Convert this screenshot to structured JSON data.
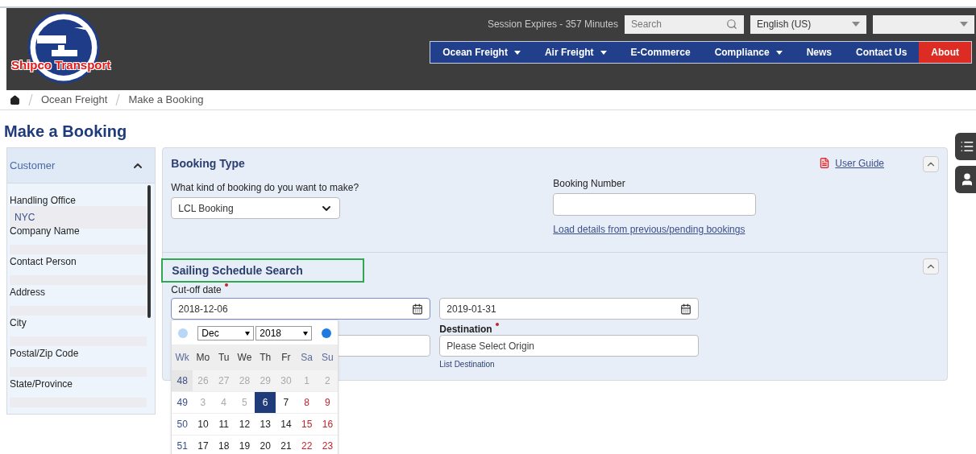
{
  "header": {
    "logo_text": "Shipco Transport",
    "session": "Session Expires - 357  Minutes",
    "search": {
      "placeholder": "Search"
    },
    "language": {
      "value": "English (US)"
    },
    "nav": [
      {
        "label": "Ocean Freight",
        "dropdown": true,
        "selected": false
      },
      {
        "label": "Air Freight",
        "dropdown": true,
        "selected": false
      },
      {
        "label": "E-Commerce",
        "dropdown": false,
        "selected": false
      },
      {
        "label": "Compliance",
        "dropdown": true,
        "selected": false
      },
      {
        "label": "News",
        "dropdown": false,
        "selected": false
      },
      {
        "label": "Contact Us",
        "dropdown": false,
        "selected": false
      },
      {
        "label": "About",
        "dropdown": false,
        "selected": true
      }
    ]
  },
  "breadcrumb": [
    "Ocean Freight",
    "Make a Booking"
  ],
  "page_title": "Make a Booking",
  "customer_panel": {
    "title": "Customer",
    "expanded": true,
    "fields": [
      {
        "label": "Handling Office",
        "value": "NYC"
      },
      {
        "label": "Company Name"
      },
      {
        "label": "Contact Person"
      },
      {
        "label": "Address"
      },
      {
        "label": "City"
      },
      {
        "label": "Postal/Zip Code"
      },
      {
        "label": "State/Province"
      }
    ]
  },
  "booking_type": {
    "title": "Booking Type",
    "question": "What kind of booking do you want to make?",
    "booking_select": "LCL Booking",
    "booking_number_label": "Booking Number",
    "load_link": "Load details from previous/pending bookings",
    "user_guide": "User Guide",
    "expanded": true
  },
  "sailing": {
    "title": "Sailing Schedule Search",
    "expanded": true,
    "cutoff_label": "Cut-off date",
    "cutoff_value": "2018-12-06",
    "end_value": "2019-01-31",
    "destination_label": "Destination",
    "destination_placeholder": "Please Select Origin",
    "destination_hint": "List Destination"
  },
  "calendar": {
    "month": "Dec",
    "year": "2018",
    "headers": [
      "Wk",
      "Mo",
      "Tu",
      "We",
      "Th",
      "Fr",
      "Sa",
      "Su"
    ],
    "weeks": [
      {
        "week": "48",
        "days": [
          {
            "day": "26",
            "kind": "other",
            "selected": false
          },
          {
            "day": "27",
            "kind": "other",
            "selected": false
          },
          {
            "day": "28",
            "kind": "other",
            "selected": false
          },
          {
            "day": "29",
            "kind": "other",
            "selected": false
          },
          {
            "day": "30",
            "kind": "other",
            "selected": false
          },
          {
            "day": "1",
            "kind": "other",
            "selected": false
          },
          {
            "day": "2",
            "kind": "other",
            "selected": false
          }
        ]
      },
      {
        "week": "49",
        "days": [
          {
            "day": "3",
            "kind": "past",
            "selected": false
          },
          {
            "day": "4",
            "kind": "past",
            "selected": false
          },
          {
            "day": "5",
            "kind": "past",
            "selected": false
          },
          {
            "day": "6",
            "kind": "weekday",
            "selected": true
          },
          {
            "day": "7",
            "kind": "weekday",
            "selected": false
          },
          {
            "day": "8",
            "kind": "weekend",
            "selected": false
          },
          {
            "day": "9",
            "kind": "weekend",
            "selected": false
          }
        ]
      },
      {
        "week": "50",
        "days": [
          {
            "day": "10",
            "kind": "weekday",
            "selected": false
          },
          {
            "day": "11",
            "kind": "weekday",
            "selected": false
          },
          {
            "day": "12",
            "kind": "weekday",
            "selected": false
          },
          {
            "day": "13",
            "kind": "weekday",
            "selected": false
          },
          {
            "day": "14",
            "kind": "weekday",
            "selected": false
          },
          {
            "day": "15",
            "kind": "weekend",
            "selected": false
          },
          {
            "day": "16",
            "kind": "weekend",
            "selected": false
          }
        ]
      },
      {
        "week": "51",
        "days": [
          {
            "day": "17",
            "kind": "weekday",
            "selected": false
          },
          {
            "day": "18",
            "kind": "weekday",
            "selected": false
          },
          {
            "day": "19",
            "kind": "weekday",
            "selected": false
          },
          {
            "day": "20",
            "kind": "weekday",
            "selected": false
          },
          {
            "day": "21",
            "kind": "weekday",
            "selected": false
          },
          {
            "day": "22",
            "kind": "weekend",
            "selected": false
          },
          {
            "day": "23",
            "kind": "weekend",
            "selected": false
          }
        ]
      }
    ]
  }
}
